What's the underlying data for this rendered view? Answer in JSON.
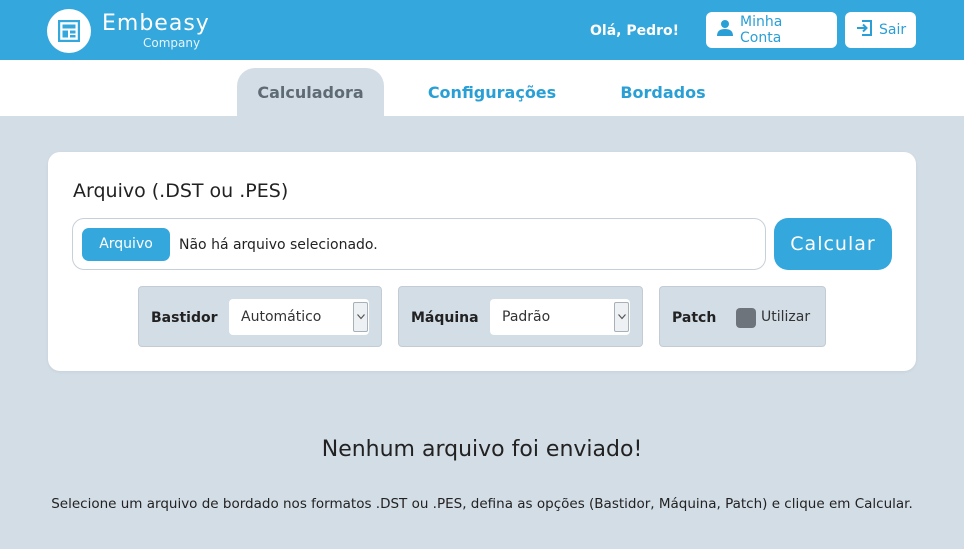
{
  "header": {
    "brand_name": "Embeasy",
    "brand_sub": "Company",
    "greeting": "Olá, Pedro!",
    "account_label": "Minha Conta",
    "exit_label": "Sair"
  },
  "tabs": [
    {
      "label": "Calculadora",
      "active": true
    },
    {
      "label": "Configurações",
      "active": false
    },
    {
      "label": "Bordados",
      "active": false
    }
  ],
  "upload": {
    "title": "Arquivo (.DST ou .PES)",
    "file_button": "Arquivo",
    "file_status": "Não há arquivo selecionado.",
    "calc_button": "Calcular"
  },
  "options": {
    "bastidor": {
      "label": "Bastidor",
      "value": "Automático"
    },
    "maquina": {
      "label": "Máquina",
      "value": "Padrão"
    },
    "patch": {
      "label": "Patch",
      "checkbox_label": "Utilizar",
      "checked": false
    }
  },
  "empty_state": {
    "title": "Nenhum arquivo foi enviado!",
    "description": "Selecione um arquivo de bordado nos formatos .DST ou .PES, defina as opções (Bastidor, Máquina, Patch) e clique em Calcular."
  },
  "colors": {
    "primary": "#34a7dc",
    "background": "#d3dde6"
  },
  "icons": {
    "logo": "grid-window-icon",
    "account": "user-icon",
    "exit": "logout-icon",
    "dropdown": "chevron-down-icon"
  }
}
